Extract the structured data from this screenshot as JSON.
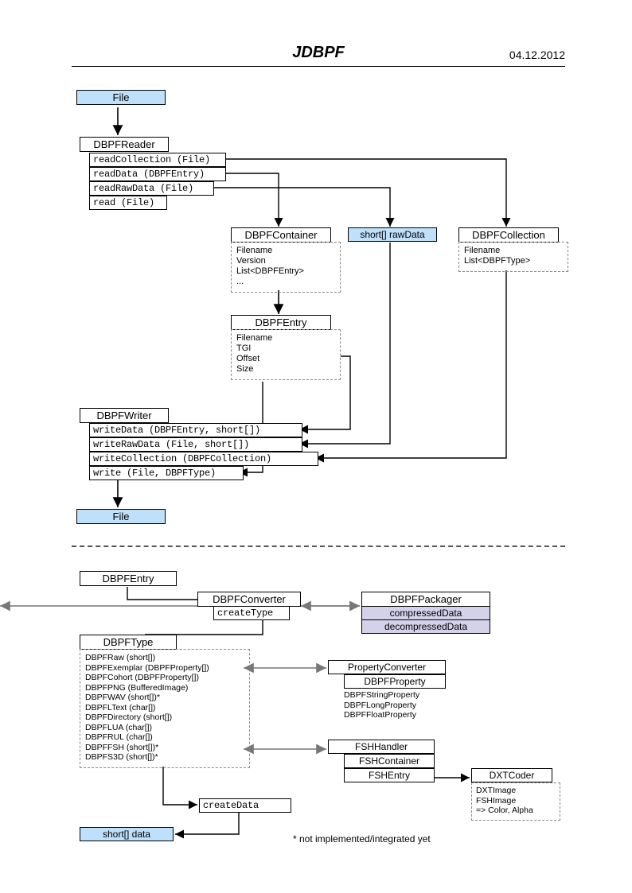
{
  "header": {
    "title": "JDBPF",
    "date": "04.12.2012"
  },
  "file_label": "File",
  "reader": {
    "title": "DBPFReader",
    "methods": [
      "readCollection (File)",
      "readData (DBPFEntry)",
      "readRawData (File)",
      "read (File)"
    ]
  },
  "container": {
    "title": "DBPFContainer",
    "fields": [
      "Filename",
      "Version",
      "List<DBPFEntry>",
      "..."
    ]
  },
  "rawData": "short[] rawData",
  "collection": {
    "title": "DBPFCollection",
    "fields": [
      "Filename",
      "List<DBPFType>"
    ]
  },
  "entry": {
    "title": "DBPFEntry",
    "fields": [
      "Filename",
      "TGI",
      "Offset",
      "Size"
    ]
  },
  "writer": {
    "title": "DBPFWriter",
    "methods": [
      "writeData (DBPFEntry, short[])",
      "writeRawData (File, short[])",
      "writeCollection (DBPFCollection)",
      "write (File, DBPFType)"
    ]
  },
  "dbpfentry2": "DBPFEntry",
  "converter": {
    "title": "DBPFConverter",
    "method": "createType"
  },
  "packager": {
    "title": "DBPFPackager",
    "row1": "compressedData",
    "row2": "decompressedData"
  },
  "dbpftype": {
    "title": "DBPFType",
    "items": [
      "DBPFRaw (short[])",
      "DBPFExemplar (DBPFProperty[])",
      "DBPFCohort (DBPFProperty[])",
      "DBPFPNG (BufferedImage)",
      "DBPFWAV (short[])*",
      "DBPFLText (char[])",
      "DBPFDirectory (short[])",
      "DBPFLUA (char[])",
      "DBPFRUL (char[])",
      "DBPFFSH (short[])*",
      "DBPFS3D (short[])*"
    ]
  },
  "propConverter": {
    "title": "PropertyConverter",
    "sub": "DBPFProperty",
    "items": [
      "DBPFStringProperty",
      "DBPFLongProperty",
      "DBPFFloatProperty"
    ]
  },
  "fsh": {
    "title": "FSHHandler",
    "sub1": "FSHContainer",
    "sub2": "FSHEntry"
  },
  "dxt": {
    "title": "DXTCoder",
    "items": [
      "DXTImage",
      "FSHImage",
      "=> Color, Alpha"
    ]
  },
  "createData": "createData",
  "shortData": "short[] data",
  "footnote": "* not implemented/integrated yet"
}
